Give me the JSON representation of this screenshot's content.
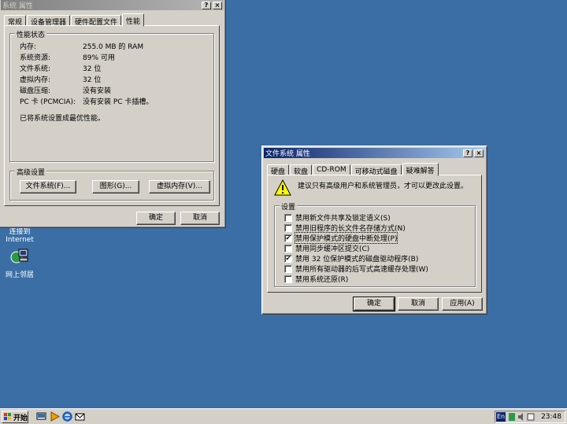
{
  "desktop": {
    "icon1_label_line1": "连接到",
    "icon1_label_line2": "Internet",
    "icon2_label": "网上邻居"
  },
  "system_window": {
    "title": "系统 属性",
    "help_btn": "?",
    "close_btn": "×",
    "tabs": [
      "常规",
      "设备管理器",
      "硬件配置文件",
      "性能"
    ],
    "status_group": "性能状态",
    "rows": [
      {
        "label": "内存:",
        "value": "255.0 MB 的 RAM"
      },
      {
        "label": "系统资源:",
        "value": "89% 可用"
      },
      {
        "label": "文件系统:",
        "value": "32 位"
      },
      {
        "label": "虚拟内存:",
        "value": "32 位"
      },
      {
        "label": "磁盘压缩:",
        "value": "没有安装"
      },
      {
        "label": "PC 卡 (PCMCIA):",
        "value": "没有安装 PC 卡插槽。"
      }
    ],
    "message": "已将系统设置成最优性能。",
    "advanced_group": "高级设置",
    "btn_filesystem": "文件系统(F)...",
    "btn_graphics": "图形(G)...",
    "btn_virtual": "虚拟内存(V)...",
    "ok": "确定",
    "cancel": "取消"
  },
  "fs_window": {
    "title": "文件系统 属性",
    "help_btn": "?",
    "close_btn": "×",
    "tabs": [
      "硬盘",
      "软盘",
      "CD-ROM",
      "可移动式磁盘",
      "疑难解答"
    ],
    "warning": "建议只有高级用户和系统管理员，才可以更改此设置。",
    "settings_group": "设置",
    "options": [
      {
        "label": "禁用新文件共享及锁定语义(S)",
        "checked": false
      },
      {
        "label": "禁用旧程序的长文件名存储方式(N)",
        "checked": false
      },
      {
        "label": "禁用保护模式的硬盘中断处理(P)",
        "checked": true
      },
      {
        "label": "禁用同步缓冲区提交(C)",
        "checked": false
      },
      {
        "label": "禁用 32 位保护模式的磁盘驱动程序(B)",
        "checked": true
      },
      {
        "label": "禁用所有驱动器的后写式高速缓存处理(W)",
        "checked": false
      },
      {
        "label": "禁用系统还原(R)",
        "checked": false
      }
    ],
    "ok": "确定",
    "cancel": "取消",
    "apply": "应用(A)"
  },
  "taskbar": {
    "start": "开始",
    "ime": "En",
    "clock": "23:48"
  }
}
